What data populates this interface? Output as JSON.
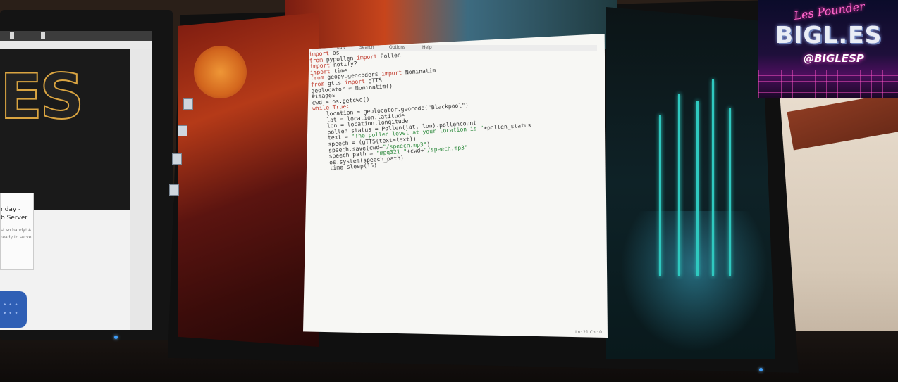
{
  "editor": {
    "menu": [
      "File",
      "Edit",
      "Search",
      "Options",
      "Help"
    ],
    "code_lines": [
      [
        {
          "t": "import ",
          "k": "kw"
        },
        {
          "t": "os",
          "k": ""
        }
      ],
      [
        {
          "t": "from ",
          "k": "kw"
        },
        {
          "t": "pypollen ",
          "k": ""
        },
        {
          "t": "import ",
          "k": "kw"
        },
        {
          "t": "Pollen",
          "k": ""
        }
      ],
      [
        {
          "t": "import ",
          "k": "kw"
        },
        {
          "t": "notify2",
          "k": ""
        }
      ],
      [
        {
          "t": "import ",
          "k": "kw"
        },
        {
          "t": "time",
          "k": ""
        }
      ],
      [
        {
          "t": "from ",
          "k": "kw"
        },
        {
          "t": "geopy.geocoders ",
          "k": ""
        },
        {
          "t": "import ",
          "k": "kw"
        },
        {
          "t": "Nominatim",
          "k": ""
        }
      ],
      [
        {
          "t": "from ",
          "k": "kw"
        },
        {
          "t": "gtts ",
          "k": ""
        },
        {
          "t": "import ",
          "k": "kw"
        },
        {
          "t": "gTTS",
          "k": ""
        }
      ],
      [
        {
          "t": "geolocator = Nominatim()",
          "k": ""
        }
      ],
      [
        {
          "t": "#images",
          "k": ""
        }
      ],
      [
        {
          "t": "cwd = os.getcwd()",
          "k": ""
        }
      ],
      [
        {
          "t": "while ",
          "k": "kw"
        },
        {
          "t": "True:",
          "k": "kw"
        }
      ],
      [
        {
          "t": "    location = geolocator.geocode(",
          "k": ""
        },
        {
          "t": "\"Blackpool\"",
          "k": ""
        },
        {
          "t": ")",
          "k": ""
        }
      ],
      [
        {
          "t": "    lat = location.latitude",
          "k": ""
        }
      ],
      [
        {
          "t": "    lon = location.longitude",
          "k": ""
        }
      ],
      [
        {
          "t": "    pollen_status = Pollen(lat, lon).pollencount",
          "k": ""
        }
      ],
      [
        {
          "t": "    text = ",
          "k": ""
        },
        {
          "t": "\"The pollen level at your location is \"",
          "k": "str"
        },
        {
          "t": "+pollen_status",
          "k": ""
        }
      ],
      [
        {
          "t": "    speech = (gTTS(text=text))",
          "k": ""
        }
      ],
      [
        {
          "t": "    speech.save(cwd+",
          "k": ""
        },
        {
          "t": "\"/speech.mp3\"",
          "k": "str"
        },
        {
          "t": ")",
          "k": ""
        }
      ],
      [
        {
          "t": "    speech_path = ",
          "k": ""
        },
        {
          "t": "\"mpg321 \"",
          "k": "str"
        },
        {
          "t": "+cwd+",
          "k": ""
        },
        {
          "t": "\"/speech.mp3\"",
          "k": "str"
        }
      ],
      [
        {
          "t": "    os.system(speech_path)",
          "k": ""
        }
      ],
      [
        {
          "t": "    time.sleep(15)",
          "k": ""
        }
      ]
    ],
    "status": "Ln: 21   Col: 0",
    "colors": {
      "keyword": "#c0392b",
      "string": "#2d8a3d",
      "text": "#333333",
      "background": "#f7f7f4"
    }
  },
  "left_screen": {
    "logo": "ES",
    "card_title_1": "nday -",
    "card_title_2": "b Server",
    "card_text": "st so handy! A ready to serve"
  },
  "watermark": {
    "script": "Les Pounder",
    "brand": "BIGL.ES",
    "handle": "@BIGLESP",
    "colors": {
      "neon": "#ff33aa",
      "chrome": "#e9edf5"
    }
  }
}
